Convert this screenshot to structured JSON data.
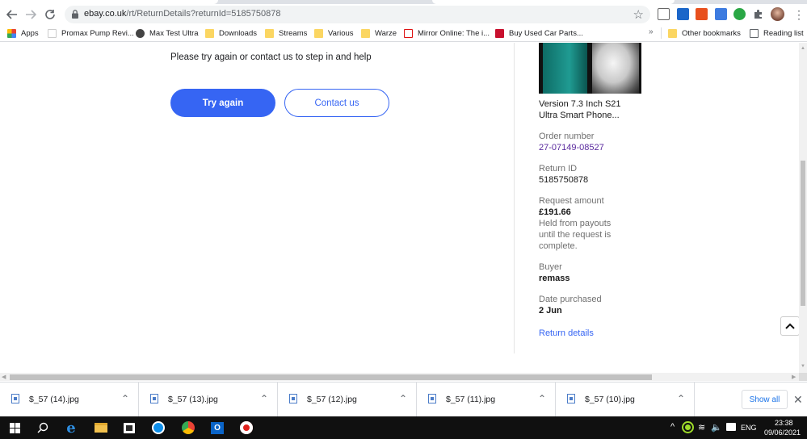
{
  "browser": {
    "url_host": "ebay.co.uk",
    "url_path": "/rt/ReturnDetails?returnId=5185750878",
    "bookmarks": [
      {
        "label": "Apps",
        "icon": "apps-grid-icon"
      },
      {
        "label": "Promax Pump Revi...",
        "icon": "page-icon"
      },
      {
        "label": "Max Test Ultra",
        "icon": "globe-icon"
      },
      {
        "label": "Downloads",
        "icon": "folder-icon"
      },
      {
        "label": "Streams",
        "icon": "folder-icon"
      },
      {
        "label": "Various",
        "icon": "folder-icon"
      },
      {
        "label": "Warze",
        "icon": "folder-icon"
      },
      {
        "label": "Mirror Online: The i...",
        "icon": "mirror-logo-icon"
      },
      {
        "label": "Buy Used Car Parts...",
        "icon": "car-parts-logo-icon"
      }
    ],
    "overflow_chevron": "»",
    "other_bookmarks": "Other bookmarks",
    "reading_list": "Reading list"
  },
  "main": {
    "message": "Please try again or contact us to step in and help",
    "try_again_label": "Try again",
    "contact_label": "Contact us"
  },
  "sidebar": {
    "item_title_line1": "Version 7.3 Inch S21",
    "item_title_line2": "Ultra Smart Phone...",
    "order_number_label": "Order number",
    "order_number": "27-07149-08527",
    "return_id_label": "Return ID",
    "return_id": "5185750878",
    "request_amount_label": "Request amount",
    "request_amount": "£191.66",
    "held_note": "Held from payouts until the request is complete.",
    "buyer_label": "Buyer",
    "buyer": "remass",
    "date_purchased_label": "Date purchased",
    "date_purchased": "2 Jun",
    "return_details_link": "Return details"
  },
  "downloads": {
    "items": [
      "$_57 (14).jpg",
      "$_57 (13).jpg",
      "$_57 (12).jpg",
      "$_57 (11).jpg",
      "$_57 (10).jpg"
    ],
    "show_all": "Show all"
  },
  "taskbar": {
    "language": "ENG",
    "time": "23:38",
    "date": "09/06/2021"
  },
  "colors": {
    "ebay_blue": "#3665f3",
    "order_purple": "#5a2a9e",
    "taskbar": "#101010"
  }
}
